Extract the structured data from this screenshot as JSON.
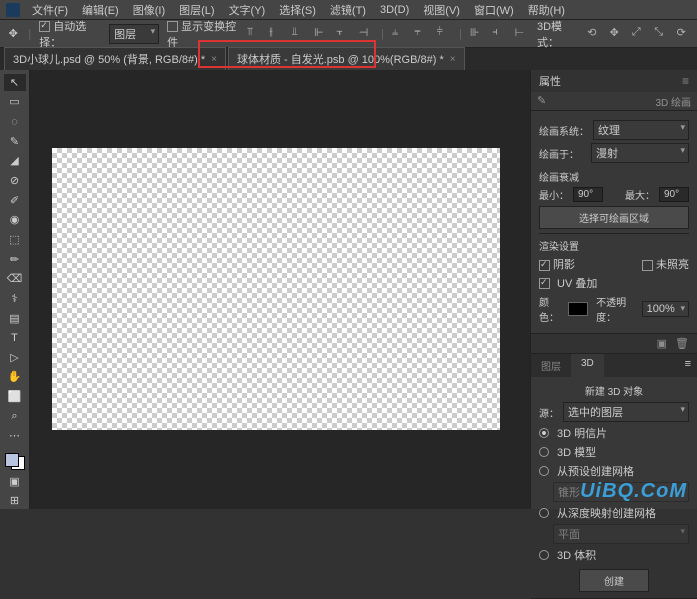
{
  "menu": {
    "items": [
      "文件(F)",
      "编辑(E)",
      "图像(I)",
      "图层(L)",
      "文字(Y)",
      "选择(S)",
      "滤镜(T)",
      "3D(D)",
      "视图(V)",
      "窗口(W)",
      "帮助(H)"
    ]
  },
  "options": {
    "auto_select_label": "自动选择：",
    "auto_select_value": "图层",
    "show_transform": "显示变换控件",
    "mode_label": "3D模式："
  },
  "tabs": [
    {
      "label": "3D小球儿.psd @ 50% (背景, RGB/8#) *",
      "active": false
    },
    {
      "label": "球体材质 - 自发光.psb @ 100%(RGB/8#) *",
      "active": true
    }
  ],
  "panels": {
    "properties": {
      "title": "属性",
      "subtitle": "3D 绘画",
      "paint_system_label": "绘画系统：",
      "paint_system_value": "纹理",
      "paint_on_label": "绘画于：",
      "paint_on_value": "漫射",
      "falloff_title": "绘画衰减",
      "min_label": "最小：",
      "min_value": "90°",
      "max_label": "最大：",
      "max_value": "90°",
      "select_area_btn": "选择可绘画区域",
      "render_title": "渲染设置",
      "shadow_label": "阴影",
      "unlit_label": "未照亮",
      "uv_overlay_label": "UV 叠加",
      "color_label": "颜色：",
      "opacity_label": "不透明度：",
      "opacity_value": "100%"
    },
    "threeD": {
      "tab_layers": "图层",
      "tab_3d": "3D",
      "create_title": "新建 3D 对象",
      "source_label": "源：",
      "source_value": "选中的图层",
      "opt_postcard": "3D 明信片",
      "opt_model": "3D 模型",
      "opt_mesh": "从预设创建网格",
      "mesh_value": "锥形",
      "opt_depth": "从深度映射创建网格",
      "depth_value": "平面",
      "opt_volume": "3D 体积",
      "create_btn": "创建"
    }
  },
  "watermark": "UiBQ.CoM",
  "tools": [
    "↖",
    "▭",
    "◌",
    "✎",
    "◢",
    "⊘",
    "✐",
    "◉",
    "⬚",
    "✏",
    "⌫",
    "⚕",
    "▤",
    "T",
    "▷",
    "✋",
    "⬜",
    "⌕",
    "⋯"
  ]
}
